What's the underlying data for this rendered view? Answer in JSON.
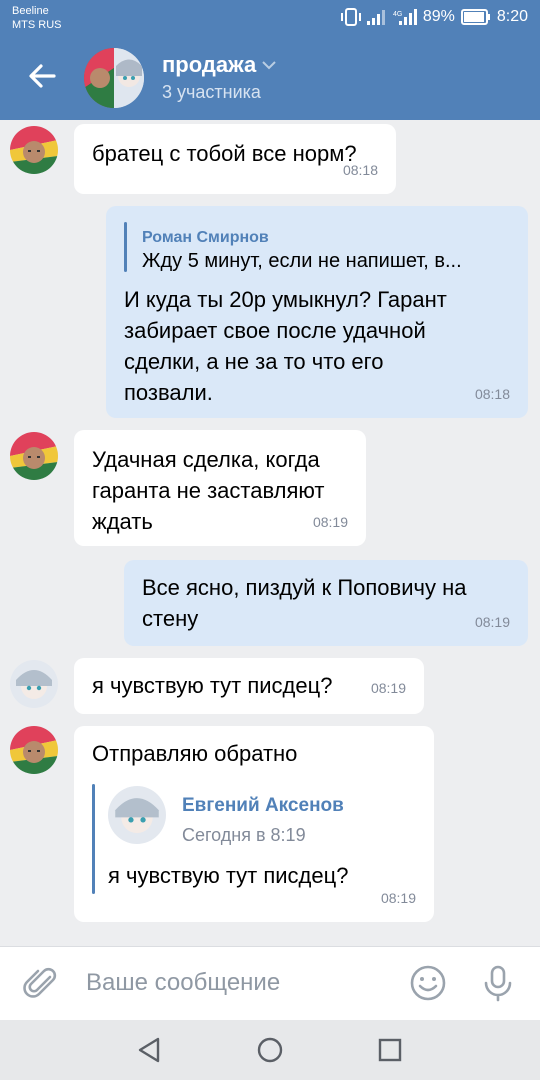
{
  "status": {
    "carrier1": "Beeline",
    "carrier2": "MTS RUS",
    "battery": "89%",
    "time": "8:20"
  },
  "header": {
    "title": "продажа",
    "subtitle": "3 участника"
  },
  "messages": [
    {
      "text": "братец с тобой все норм?",
      "time": "08:18"
    },
    {
      "quote_name": "Роман Смирнов",
      "quote_text": "Жду 5 минут, если не напишет, в...",
      "text_lines": [
        "И куда ты 20р умыкнул? Гарант",
        "забирает свое после удачной",
        "сделки, а не за то что его",
        "позвали."
      ],
      "time": "08:18"
    },
    {
      "text_lines": [
        "Удачная сделка, когда",
        "гаранта не заставляют",
        "ждать"
      ],
      "time": "08:19"
    },
    {
      "text_lines": [
        "Все ясно, пиздуй к Поповичу на",
        "стену"
      ],
      "time": "08:19"
    },
    {
      "text": "я чувствую тут писдец?",
      "time": "08:19"
    },
    {
      "text": "Отправляю обратно",
      "fwd_name": "Евгений Аксенов",
      "fwd_date": "Сегодня в 8:19",
      "fwd_text": "я чувствую тут писдец?",
      "time": "08:19"
    }
  ],
  "input": {
    "placeholder": "Ваше сообщение"
  },
  "colors": {
    "brand": "#5181b8",
    "outgoing_bubble": "#dae8f8",
    "background": "#edeef0"
  }
}
